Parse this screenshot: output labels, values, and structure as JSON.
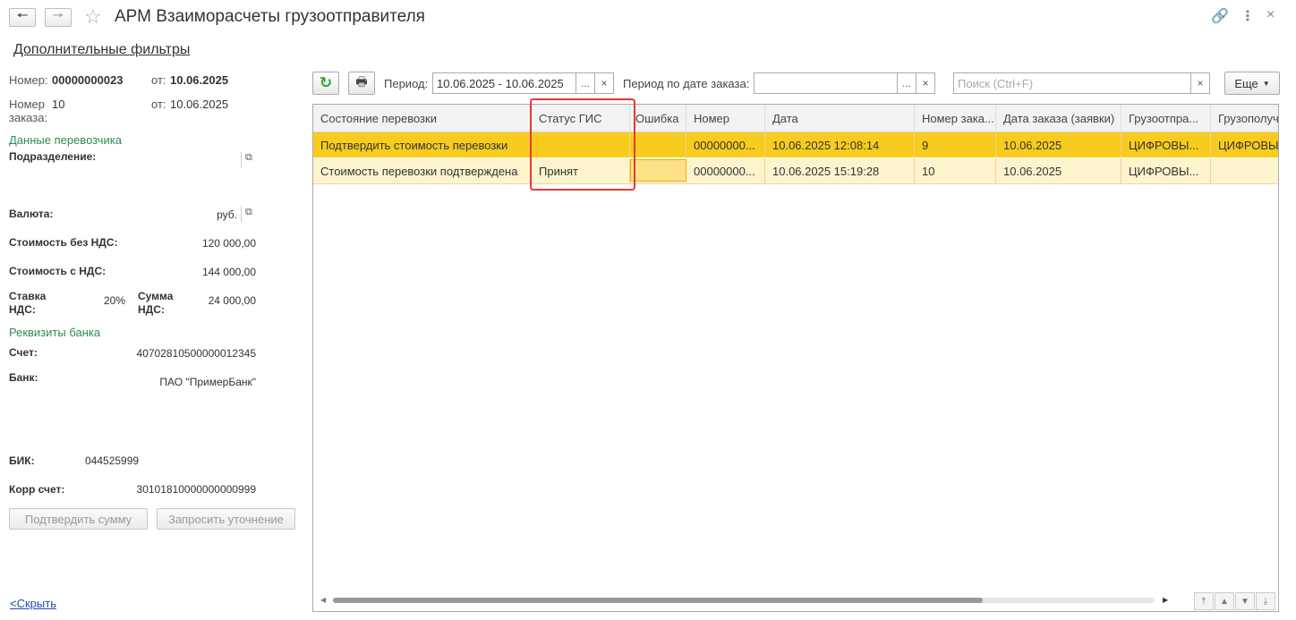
{
  "header": {
    "title": "АРМ Взаиморасчеты грузоотправителя"
  },
  "filters_link": "Дополнительные фильтры",
  "left": {
    "number_label": "Номер:",
    "number_value": "00000000023",
    "from_label1": "от:",
    "from_value1": "10.06.2025",
    "order_label_line1": "Номер",
    "order_label_line2": "заказа:",
    "order_value": "10",
    "from_label2": "от:",
    "from_value2": "10.06.2025",
    "carrier_section": "Данные перевозчика",
    "division_label": "Подразделение:",
    "currency_label": "Валюта:",
    "currency_value": "руб.",
    "cost_no_vat_label": "Стоимость без НДС:",
    "cost_no_vat_value": "120 000,00",
    "cost_vat_label": "Стоимость с НДС:",
    "cost_vat_value": "144 000,00",
    "vat_rate_label_line1": "Ставка",
    "vat_rate_label_line2": "НДС:",
    "vat_rate_value": "20%",
    "vat_sum_label_line1": "Сумма",
    "vat_sum_label_line2": "НДС:",
    "vat_sum_value": "24 000,00",
    "bank_section": "Реквизиты банка",
    "account_label": "Счет:",
    "account_value": "40702810500000012345",
    "bank_label": "Банк:",
    "bank_value": "ПАО \"ПримерБанк\"",
    "bik_label": "БИК:",
    "bik_value": "044525999",
    "corr_label": "Корр счет:",
    "corr_value": "30101810000000000999",
    "confirm_button": "Подтвердить сумму",
    "request_button": "Запросить уточнение",
    "hide_link": "<Скрыть"
  },
  "toolbar": {
    "period_label": "Период:",
    "period_value": "10.06.2025 - 10.06.2025",
    "order_period_label": "Период по дате заказа:",
    "order_period_value": "",
    "search_placeholder": "Поиск (Ctrl+F)",
    "more_button": "Еще",
    "ellipsis": "...",
    "clear": "×"
  },
  "table": {
    "columns": [
      "Состояние перевозки",
      "Статус ГИС",
      "Ошибка",
      "Номер",
      "Дата",
      "Номер зака...",
      "Дата заказа (заявки)",
      "Грузоотпра...",
      "Грузополуч..."
    ],
    "rows": [
      [
        "Подтвердить стоимость перевозки",
        "",
        "",
        "00000000...",
        "10.06.2025 12:08:14",
        "9",
        "10.06.2025",
        "ЦИФРОВЫ...",
        "ЦИФРОВЫ"
      ],
      [
        "Стоимость перевозки подтверждена",
        "Принят",
        "",
        "00000000...",
        "10.06.2025 15:19:28",
        "10",
        "10.06.2025",
        "ЦИФРОВЫ...",
        ""
      ]
    ]
  },
  "colors": {
    "selected_row": "#f8cc1e",
    "row_alt": "#fdf3cc",
    "highlight": "#e53935",
    "green": "#2e8b57"
  }
}
